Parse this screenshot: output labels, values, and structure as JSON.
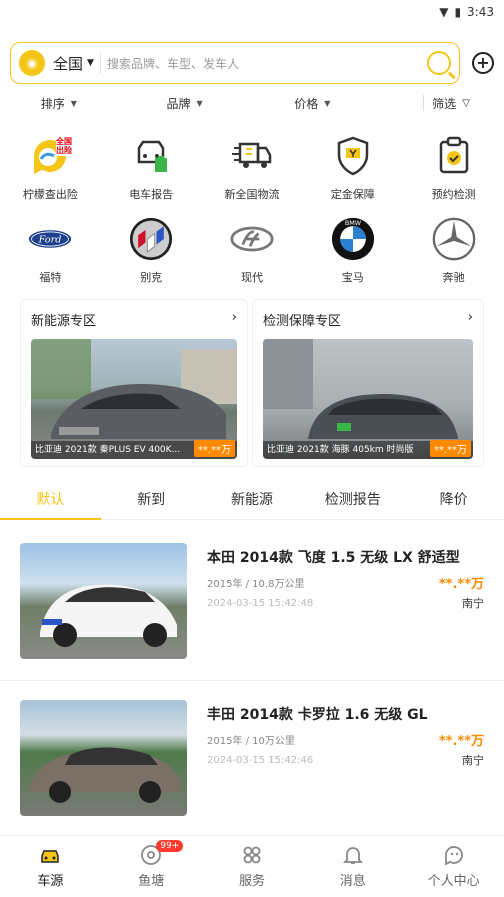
{
  "status": {
    "time": "3:43"
  },
  "search": {
    "city": "全国",
    "placeholder": "搜索品牌、车型、发车人"
  },
  "filters": [
    {
      "label": "排序"
    },
    {
      "label": "品牌"
    },
    {
      "label": "价格"
    },
    {
      "label": "筛选"
    }
  ],
  "services": [
    {
      "label": "柠檬查出险",
      "badge": "全国\n出险"
    },
    {
      "label": "电车报告"
    },
    {
      "label": "新全国物流"
    },
    {
      "label": "定金保障"
    },
    {
      "label": "预约检测"
    }
  ],
  "brands": [
    {
      "label": "福特",
      "logo_text": "Ford"
    },
    {
      "label": "别克"
    },
    {
      "label": "现代"
    },
    {
      "label": "宝马",
      "logo_text": "BMW"
    },
    {
      "label": "奔驰"
    }
  ],
  "zones": [
    {
      "title": "新能源专区",
      "caption": "比亚迪 2021款 秦PLUS EV 400K...",
      "price": "**.**万"
    },
    {
      "title": "检测保障专区",
      "caption": "比亚迪 2021款 海豚 405km 时尚版",
      "price": "**.**万"
    }
  ],
  "tabs": [
    "默认",
    "新到",
    "新能源",
    "检测报告",
    "降价"
  ],
  "listings": [
    {
      "title": "本田 2014款 飞度 1.5 无级 LX 舒适型",
      "meta": "2015年 / 10.8万公里",
      "date": "2024-03-15 15:42:48",
      "price": "**.**万",
      "city": "南宁"
    },
    {
      "title": "丰田 2014款 卡罗拉 1.6 无级 GL",
      "meta": "2015年 / 10万公里",
      "date": "2024-03-15 15:42:46",
      "price": "**.**万",
      "city": "南宁"
    }
  ],
  "nav": [
    {
      "label": "车源"
    },
    {
      "label": "鱼塘",
      "badge": "99+"
    },
    {
      "label": "服务"
    },
    {
      "label": "消息"
    },
    {
      "label": "个人中心"
    }
  ],
  "colors": {
    "accent": "#f5c518",
    "price": "#ff8a00"
  }
}
